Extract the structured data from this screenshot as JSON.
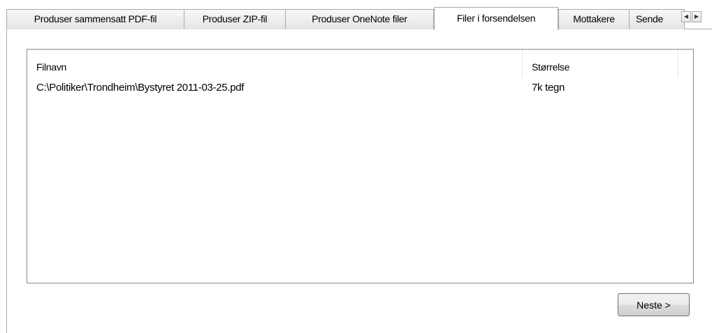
{
  "tabs": [
    {
      "label": "Produser sammensatt PDF-fil",
      "active": false
    },
    {
      "label": "Produser ZIP-fil",
      "active": false
    },
    {
      "label": "Produser OneNote filer",
      "active": false
    },
    {
      "label": "Filer i forsendelsen",
      "active": true
    },
    {
      "label": "Mottakere",
      "active": false
    },
    {
      "label": "Sende",
      "active": false
    }
  ],
  "tab_scroll": {
    "left_icon": "arrow-left-icon",
    "right_icon": "arrow-right-icon"
  },
  "file_list": {
    "columns": [
      "Filnavn",
      "Størrelse"
    ],
    "rows": [
      {
        "filename": "C:\\Politiker\\Trondheim\\Bystyret 2011-03-25.pdf",
        "size": "7k tegn"
      }
    ]
  },
  "buttons": {
    "next_label": "Neste >"
  }
}
